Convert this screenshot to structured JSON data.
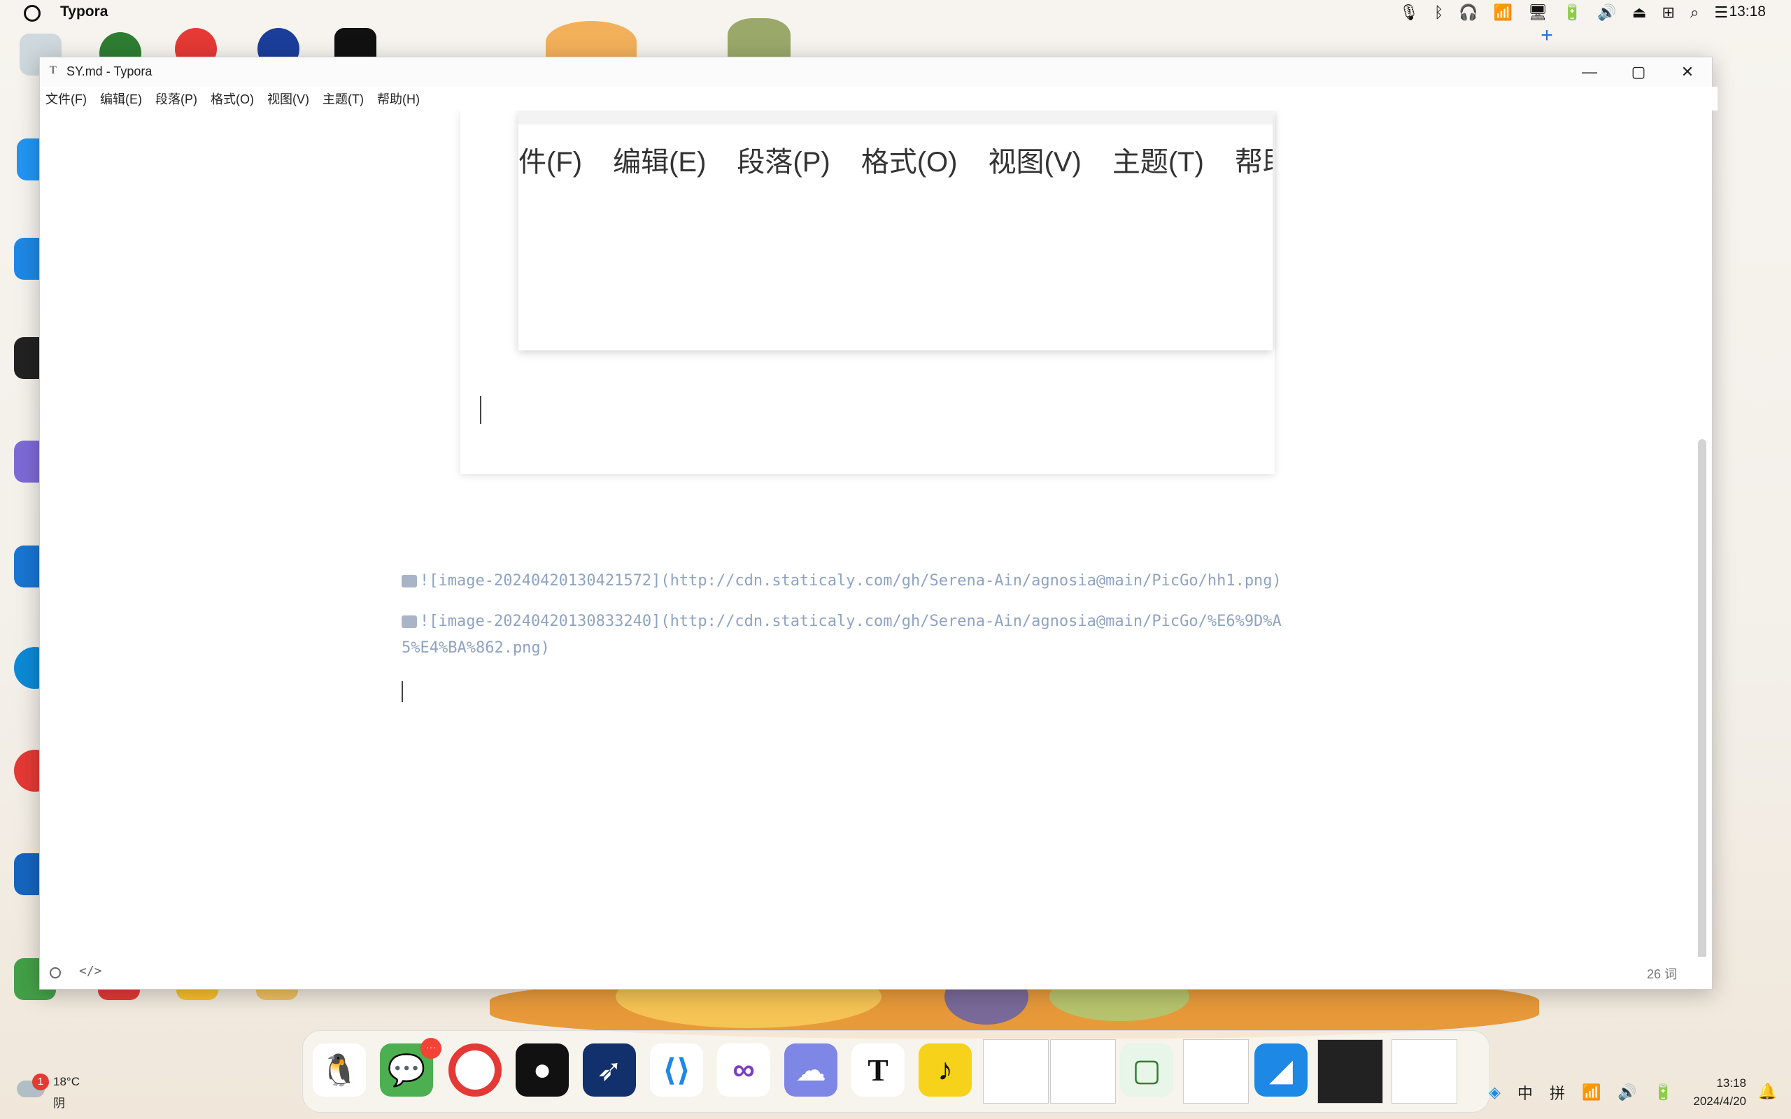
{
  "topbar": {
    "app_name": "Typora",
    "time": "13:18",
    "icons": [
      "mic-icon",
      "bluetooth-icon",
      "headphones-icon",
      "wifi-icon",
      "display-icon",
      "battery-icon",
      "volume-icon",
      "eject-icon",
      "ime-icon",
      "search-icon",
      "control-center-icon"
    ]
  },
  "window": {
    "title": "SY.md - Typora",
    "title_icon": "T",
    "controls": {
      "minimize": "—",
      "maximize": "▢",
      "close": "✕"
    },
    "menu": [
      "文件(F)",
      "编辑(E)",
      "段落(P)",
      "格式(O)",
      "视图(V)",
      "主题(T)",
      "帮助(H)"
    ],
    "embedded_menu": [
      "件(F)",
      "编辑(E)",
      "段落(P)",
      "格式(O)",
      "视图(V)",
      "主题(T)",
      "帮助"
    ],
    "md_lines": [
      "![image-20240420130421572](http://cdn.staticaly.com/gh/Serena-Ain/agnosia@main/PicGo/hh1.png)",
      "![image-20240420130833240](http://cdn.staticaly.com/gh/Serena-Ain/agnosia@main/PicGo/%E6%9D%A",
      "5%E4%BA%862.png)"
    ],
    "status": {
      "source_toggle": "</>",
      "word_count": "26 词"
    }
  },
  "dock": {
    "apps": [
      "QQ",
      "WeChat",
      "Chrome",
      "GitHub",
      "Rocket",
      "VS Code",
      "Visual Studio",
      "Weather",
      "Typora",
      "QQ Music"
    ],
    "wechat_badge": "···"
  },
  "taskbar": {
    "weather_badge": "1",
    "temperature": "18°C",
    "condition": "阴",
    "ime_lang": "中",
    "ime_mode": "拼",
    "time": "13:18",
    "date": "2024/4/20"
  },
  "colors": {
    "accent_blue": "#1e88e5",
    "md_text": "#8fa3c1"
  }
}
